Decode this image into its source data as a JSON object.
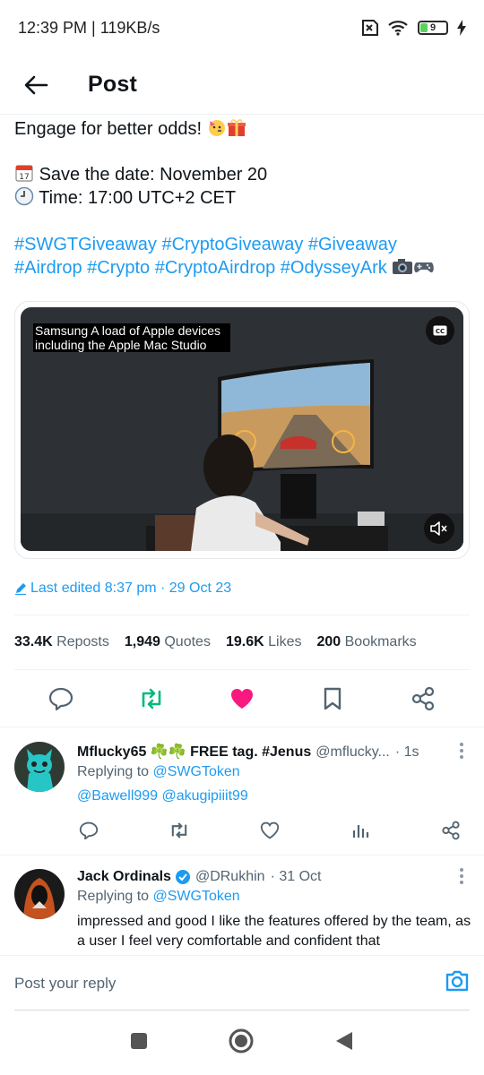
{
  "status_bar": {
    "time": "12:39 PM | 119KB/s",
    "battery": "9"
  },
  "header": {
    "title": "Post"
  },
  "post": {
    "line_odds": "Engage for better odds!",
    "line_date": "Save the date: November 20",
    "line_time": "Time: 17:00 UTC+2 CET",
    "hashtags_1": "#SWGTGiveaway #CryptoGiveaway #Giveaway",
    "hashtags_2": "#Airdrop #Crypto #CryptoAirdrop #OdysseyArk",
    "video_caption": "Samsung A load of Apple devices including the Apple Mac Studio",
    "cc_label": "CC",
    "edited": "Last edited 8:37 pm · 29 Oct 23"
  },
  "stats": [
    {
      "value": "33.4K",
      "label": "Reposts"
    },
    {
      "value": "1,949",
      "label": "Quotes"
    },
    {
      "value": "19.6K",
      "label": "Likes"
    },
    {
      "value": "200",
      "label": "Bookmarks"
    }
  ],
  "replies": [
    {
      "name": "Mflucky65 ☘️☘️ FREE tag. #Jenus",
      "handle": "@mflucky...",
      "time": "· 1s",
      "replying_prefix": "Replying to ",
      "replying_to": "@SWGToken",
      "mentions": "@Bawell999 @akugipiiit99"
    },
    {
      "name": "Jack Ordinals",
      "handle": "@DRukhin",
      "time": "· 31 Oct",
      "replying_prefix": "Replying to ",
      "replying_to": "@SWGToken",
      "text": "impressed and good I like the features offered by the team, as a user I feel very comfortable and confident that"
    }
  ],
  "reply_bar": {
    "placeholder": "Post your reply"
  },
  "colors": {
    "accent": "#1d9bf0",
    "repost_green": "#00ba7c",
    "like_pink": "#f91880"
  }
}
